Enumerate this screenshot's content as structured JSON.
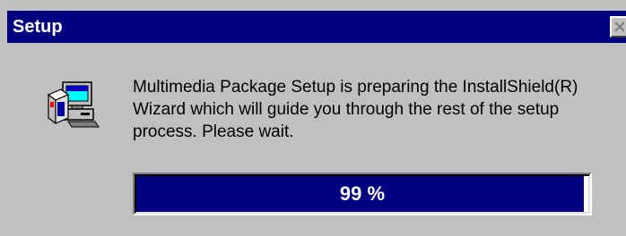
{
  "window": {
    "title": "Setup"
  },
  "message": {
    "lines": [
      "Multimedia Package Setup is preparing the InstallShield(R)",
      "Wizard which will guide you through the rest of the setup",
      "process.  Please wait."
    ]
  },
  "progress": {
    "label": "99 %",
    "value": 0.99
  },
  "icons": {
    "app": "computer-setup-icon",
    "close": "close-icon"
  },
  "colors": {
    "titlebar": "#000080",
    "face": "#c0c0c0",
    "progress_fill": "#000080"
  }
}
